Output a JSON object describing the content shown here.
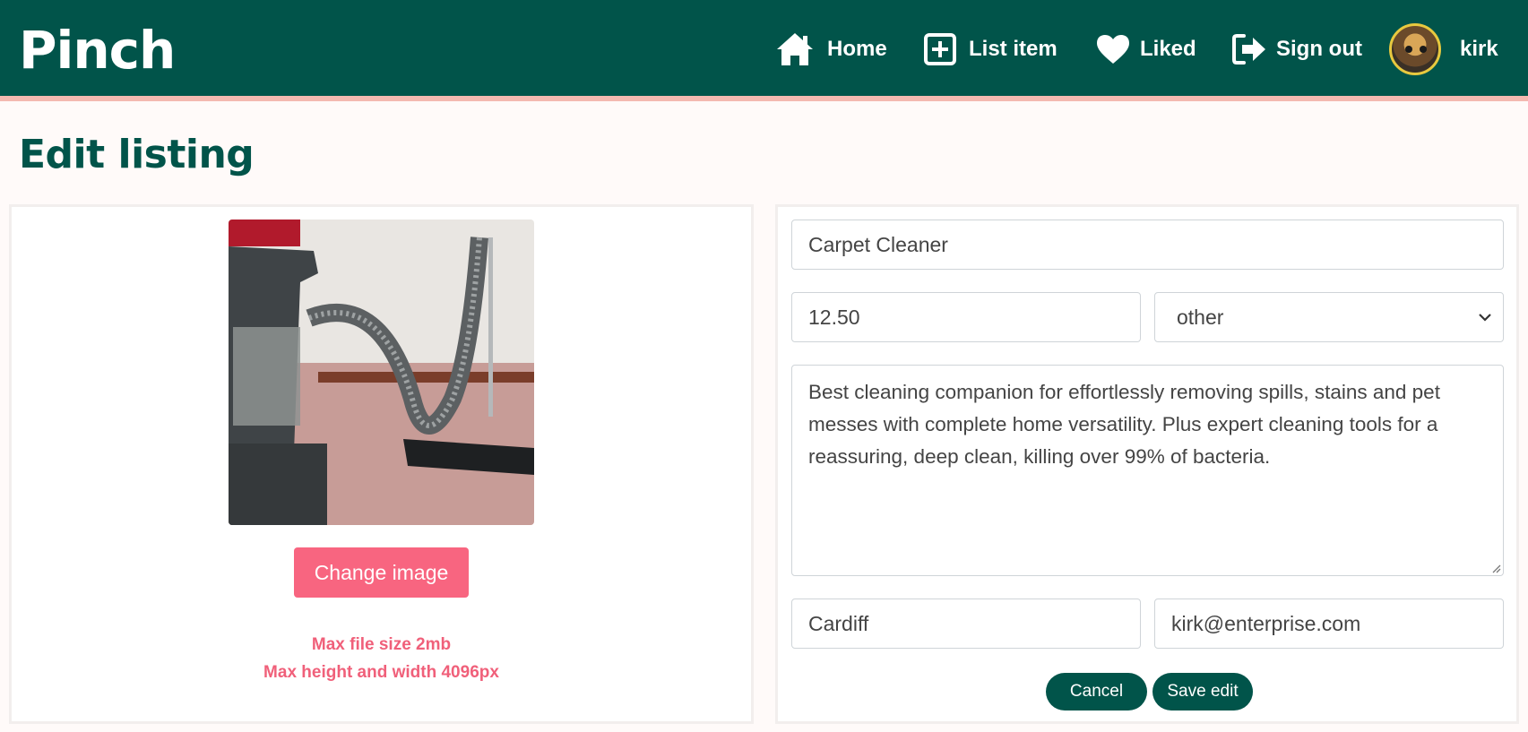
{
  "app": {
    "brand": "Pinch"
  },
  "nav": {
    "home": "Home",
    "list_item": "List item",
    "liked": "Liked",
    "sign_out": "Sign out",
    "username": "kirk"
  },
  "page": {
    "title": "Edit listing"
  },
  "image_panel": {
    "change_button": "Change image",
    "hint_size": "Max file size 2mb",
    "hint_dimensions": "Max height and width 4096px"
  },
  "form": {
    "title_value": "Carpet Cleaner",
    "price_value": "12.50",
    "category_selected": "other",
    "description_value": "Best cleaning companion for effortlessly removing spills, stains and pet messes with complete home versatility. Plus expert cleaning tools for a reassuring, deep clean, killing over 99% of bacteria.",
    "location_value": "Cardiff",
    "email_value": "kirk@enterprise.com",
    "cancel_button": "Cancel",
    "save_button": "Save edit"
  },
  "colors": {
    "brand_green": "#01544a",
    "accent_pink": "#f86580",
    "nav_border": "#f4b9b0"
  },
  "icons": [
    "home-icon",
    "plus-square-icon",
    "heart-icon",
    "sign-out-icon",
    "chevron-down-icon"
  ]
}
